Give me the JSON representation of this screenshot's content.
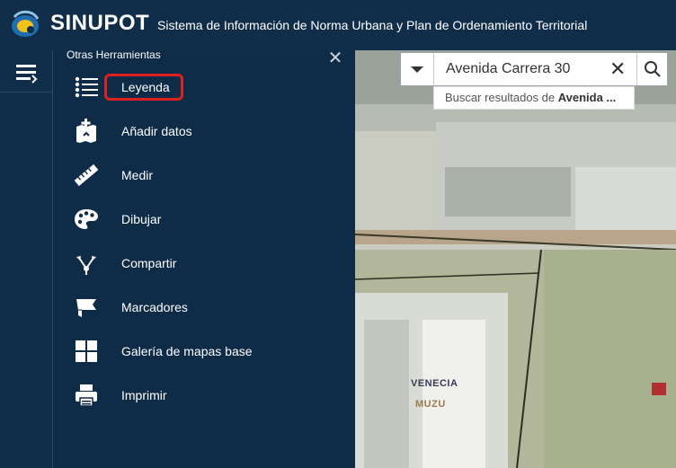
{
  "app": {
    "brand": "SINUPOT",
    "subtitle": "Sistema de Información de Norma Urbana y Plan de Ordenamiento Territorial"
  },
  "panel": {
    "title": "Otras Herramientas",
    "close_icon": "close-icon",
    "tools": [
      {
        "label": "Leyenda",
        "icon": "legend-list-icon",
        "highlighted": true
      },
      {
        "label": "Añadir datos",
        "icon": "add-data-icon"
      },
      {
        "label": "Medir",
        "icon": "ruler-icon"
      },
      {
        "label": "Dibujar",
        "icon": "palette-icon"
      },
      {
        "label": "Compartir",
        "icon": "share-icon"
      },
      {
        "label": "Marcadores",
        "icon": "bookmark-icon"
      },
      {
        "label": "Galería de mapas base",
        "icon": "basemap-gallery-icon"
      },
      {
        "label": "Imprimir",
        "icon": "print-icon"
      }
    ]
  },
  "search": {
    "value": "Avenida Carrera 30",
    "suggestion_prefix": "Buscar resultados de ",
    "suggestion_term": "Avenida ..."
  },
  "map": {
    "labels": [
      "VENECIA",
      "MUZU"
    ]
  },
  "colors": {
    "header": "#102d4a",
    "panel": "#0e2b47",
    "highlight": "#e01f1f"
  }
}
